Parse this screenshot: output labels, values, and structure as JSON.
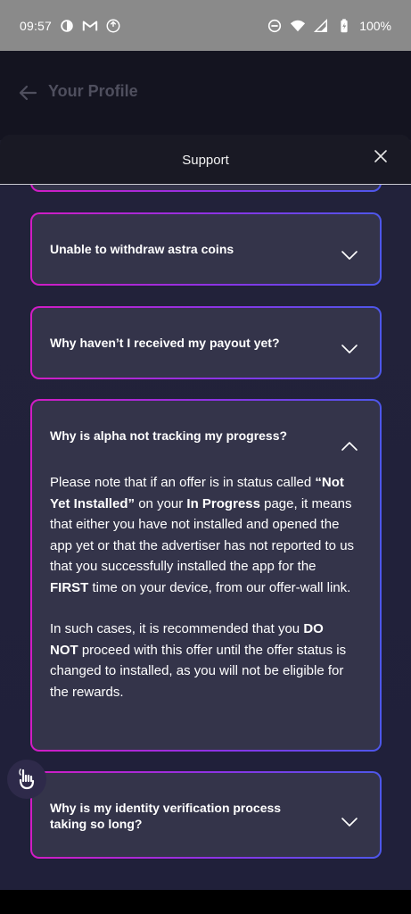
{
  "status_bar": {
    "time": "09:57",
    "battery": "100%",
    "left_icons": [
      "brightness-icon",
      "gmail-icon",
      "sync-icon"
    ],
    "right_icons": [
      "dnd-icon",
      "wifi-icon",
      "signal-icon",
      "battery-icon"
    ]
  },
  "background": {
    "title": "Your Profile"
  },
  "sheet": {
    "title": "Support"
  },
  "faq": [
    {
      "question": "Unable to withdraw astra coins",
      "expanded": false
    },
    {
      "question": "Why haven’t I received my payout yet?",
      "expanded": false
    },
    {
      "question": "Why is alpha not tracking my progress?",
      "expanded": true,
      "answer": {
        "p1": {
          "t1": "Please note that if an offer is in status called ",
          "b1": "“Not Yet Installed”",
          "t2": " on your ",
          "b2": "In Progress",
          "t3": " page, it means that either you have not installed and opened the app yet or that the advertiser has not reported to us that you successfully installed the app for the ",
          "b3": "FIRST",
          "t4": " time on your device, from our offer-wall link."
        },
        "p2": {
          "t1": "In such cases, it is recommended that you ",
          "b1": "DO NOT",
          "t2": " proceed with this offer until the offer status is changed to installed, as you will not be eligible for the rewards."
        }
      }
    },
    {
      "question": "Why is my identity verification process taking so long?",
      "expanded": false
    }
  ],
  "colors": {
    "border_gradient_start": "#d21cc4",
    "border_gradient_end": "#4d57ea",
    "card_bg": "#34344a",
    "sheet_bg": "#222238"
  }
}
